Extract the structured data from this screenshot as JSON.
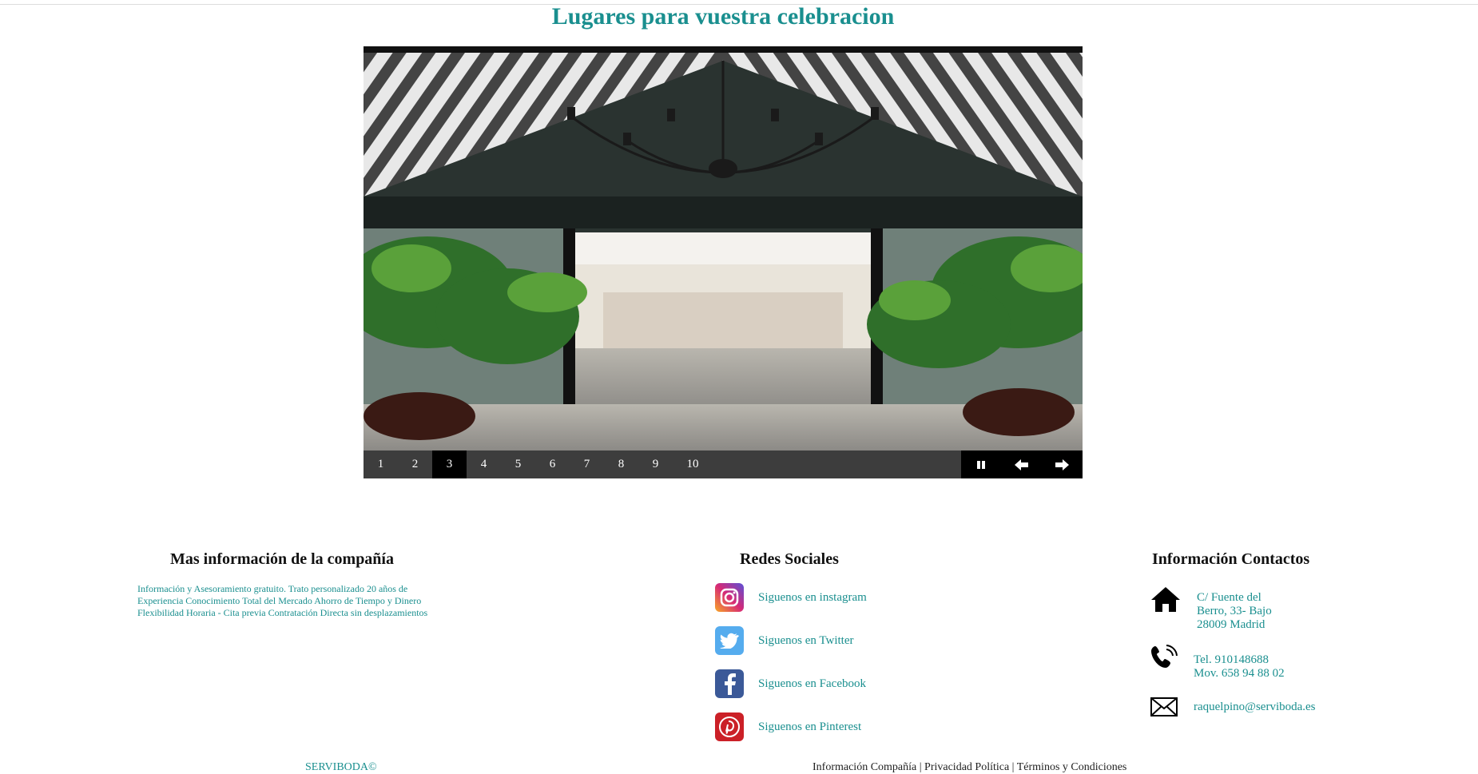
{
  "title": "Lugares para vuestra celebracion",
  "slider": {
    "pages": [
      "1",
      "2",
      "3",
      "4",
      "5",
      "6",
      "7",
      "8",
      "9",
      "10"
    ],
    "active_page": "3",
    "controls": [
      "pause-icon",
      "arrow-left-icon",
      "arrow-right-icon"
    ]
  },
  "footer": {
    "company": {
      "heading": "Mas información de la compañía",
      "text": "Información y Asesoramiento gratuito. Trato personalizado 20 años de Experiencia Conocimiento Total del Mercado Ahorro de Tiempo y Dinero Flexibilidad Horaria - Cita previa Contratación Directa sin desplazamientos"
    },
    "social": {
      "heading": "Redes Sociales",
      "items": [
        {
          "label": "Siguenos en instagram",
          "icon": "instagram-icon",
          "color": "#d62976"
        },
        {
          "label": "Siguenos en Twitter",
          "icon": "twitter-icon",
          "color": "#55acee"
        },
        {
          "label": "Siguenos en Facebook",
          "icon": "facebook-icon",
          "color": "#3b5998"
        },
        {
          "label": "Siguenos en Pinterest",
          "icon": "pinterest-icon",
          "color": "#cb2027"
        }
      ]
    },
    "contact": {
      "heading": "Información Contactos",
      "address": [
        "C/ Fuente del",
        "Berro, 33- Bajo",
        "28009 Madrid"
      ],
      "phone": [
        "Tel. 910148688",
        "Mov. 658 94 88 02"
      ],
      "email": "raquelpino@serviboda.es"
    },
    "bottom_left": "SERVIBODA©",
    "bottom_right": "Información Compañía | Privacidad Política | Términos y Condiciones"
  },
  "colors": {
    "accent": "#1a8f8f",
    "slider_bar": "#3d3d3d"
  }
}
